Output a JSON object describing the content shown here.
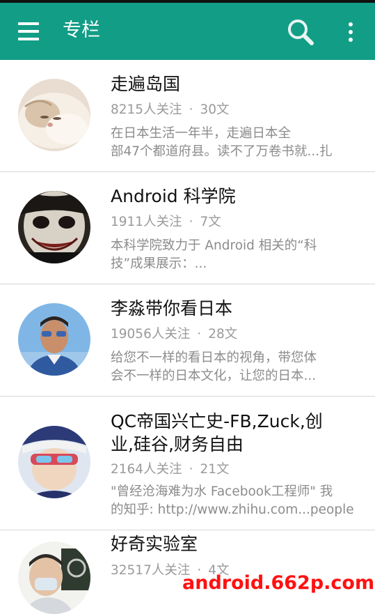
{
  "toolbar": {
    "title": "专栏",
    "color": "#129d86",
    "icons": [
      "menu-icon",
      "search-icon",
      "more-vert-icon"
    ]
  },
  "columns": [
    {
      "title": "走遍岛国",
      "followers": "8215人关注",
      "posts": "30文",
      "desc_line1": "在日本生活一年半，走遍日本全",
      "desc_line2": "部47个都道府县。读不了万卷书就...扎"
    },
    {
      "title": "Android 科学院",
      "followers": "1911人关注",
      "posts": "7文",
      "desc_line1": "本科学院致力于 Android 相关的“科",
      "desc_line2": "技”成果展示：..."
    },
    {
      "title": "李淼带你看日本",
      "followers": "19056人关注",
      "posts": "28文",
      "desc_line1": "给您不一样的看日本的视角，带您体",
      "desc_line2": "会不一样的日本文化，让您的日本..."
    },
    {
      "title_line1": "QC帝国兴亡史-FB,Zuck,创",
      "title_line2": "业,硅谷,财务自由",
      "followers": "2164人关注",
      "posts": "21文",
      "desc_line1": "\"曾经沧海难为水 Facebook工程师\" 我",
      "desc_line2": "的知乎: http://www.zhihu.com...people"
    },
    {
      "title": "好奇实验室",
      "followers": "32517人关注",
      "posts": "4文"
    }
  ],
  "separator": "·",
  "watermark": "android.662p.com"
}
